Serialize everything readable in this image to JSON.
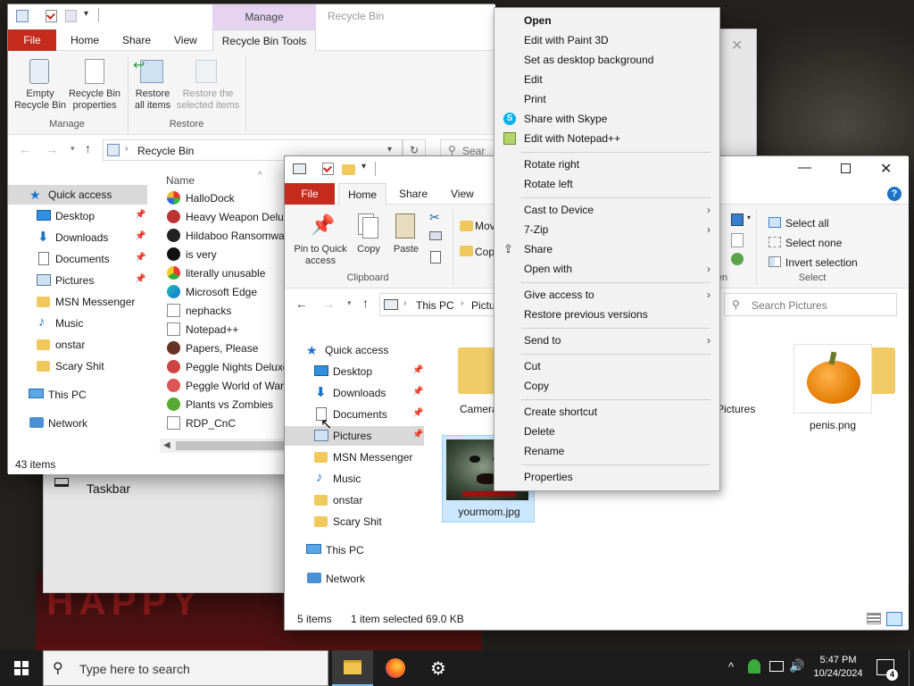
{
  "desktop": {
    "text": "HAPPY"
  },
  "recycle": {
    "title": "Recycle Bin",
    "context_tab": "Manage",
    "tabs": [
      "File",
      "Home",
      "Share",
      "View",
      "Recycle Bin Tools"
    ],
    "ribbon": {
      "empty": "Empty Recycle Bin",
      "props": "Recycle Bin properties",
      "restore_all": "Restore all items",
      "restore_sel": "Restore the selected items",
      "grp_manage": "Manage",
      "grp_restore": "Restore"
    },
    "address": "Recycle Bin",
    "search": "Sear",
    "col_name": "Name",
    "nav": {
      "quick": "Quick access",
      "desktop": "Desktop",
      "downloads": "Downloads",
      "documents": "Documents",
      "pictures": "Pictures",
      "msn": "MSN Messenger",
      "music": "Music",
      "onstar": "onstar",
      "scary": "Scary Shit",
      "thispc": "This PC",
      "network": "Network"
    },
    "files": [
      "HalloDock",
      "Heavy Weapon Delux",
      "Hildaboo Ransomwar",
      "is very",
      "literally unusable",
      "Microsoft Edge",
      "nephacks",
      "Notepad++",
      "Papers, Please",
      "Peggle Nights Deluxe",
      "Peggle World of Warc",
      "Plants vs Zombies",
      "RDP_CnC"
    ],
    "status": "43 items"
  },
  "bgwin": {
    "item": "Taskbar"
  },
  "pictures": {
    "tabs": [
      "File",
      "Home",
      "Share",
      "View"
    ],
    "ribbon": {
      "pin": "Pin to Quick access",
      "copy": "Copy",
      "paste": "Paste",
      "move": "Mov",
      "cop": "Cop",
      "clipboard": "Clipboard",
      "select_all": "Select all",
      "select_none": "Select none",
      "invert": "Invert selection",
      "select": "Select",
      "open_frag": "en"
    },
    "address": {
      "thispc": "This PC",
      "pictures": "Pictu"
    },
    "search_placeholder": "Search Pictures",
    "nav": {
      "quick": "Quick access",
      "desktop": "Desktop",
      "downloads": "Downloads",
      "documents": "Documents",
      "pictures": "Pictures",
      "msn": "MSN Messenger",
      "music": "Music",
      "onstar": "onstar",
      "scary": "Scary Shit",
      "thispc": "This PC",
      "network": "Network"
    },
    "items": {
      "camera": "Camera",
      "saved": "Pictures",
      "penis": "penis.png",
      "yourmom": "yourmom.jpg"
    },
    "status": {
      "count": "5 items",
      "selected": "1 item selected  69.0 KB"
    }
  },
  "context_menu": {
    "open": "Open",
    "paint3d": "Edit with Paint 3D",
    "desktop_bg": "Set as desktop background",
    "edit": "Edit",
    "print": "Print",
    "skype": "Share with Skype",
    "notepad": "Edit with Notepad++",
    "rot_right": "Rotate right",
    "rot_left": "Rotate left",
    "cast": "Cast to Device",
    "zip": "7-Zip",
    "share": "Share",
    "open_with": "Open with",
    "access": "Give access to",
    "restore": "Restore previous versions",
    "send": "Send to",
    "cut": "Cut",
    "copy": "Copy",
    "shortcut": "Create shortcut",
    "delete": "Delete",
    "rename": "Rename",
    "properties": "Properties"
  },
  "taskbar": {
    "search": "Type here to search",
    "time": "5:47 PM",
    "date": "10/24/2024",
    "notif_count": "4"
  },
  "colors": {
    "file_tab": "#c42b1c",
    "manage_tab": "#e6d3f2",
    "accent": "#0078d4",
    "select_bg": "#cce8ff"
  }
}
